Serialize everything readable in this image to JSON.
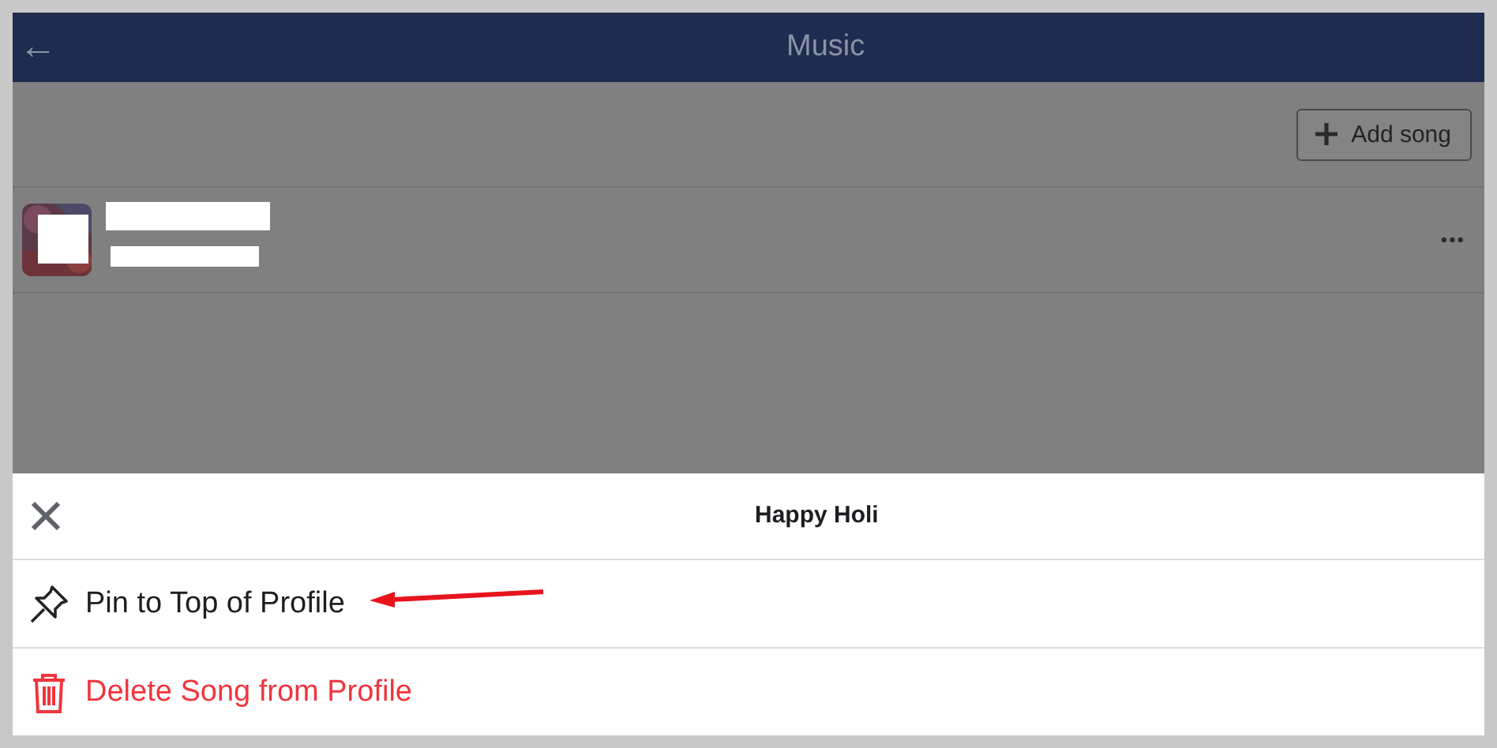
{
  "header": {
    "back": "←",
    "title": "Music"
  },
  "toolbar": {
    "add_button": "Add song"
  },
  "songs": [
    {
      "more": "•••"
    }
  ],
  "sheet": {
    "title": "Happy Holi",
    "items": [
      {
        "kind": "pin",
        "label": "Pin to Top of Profile",
        "annotated": true
      },
      {
        "kind": "delete",
        "label": "Delete Song from Profile",
        "annotated": false
      }
    ]
  }
}
